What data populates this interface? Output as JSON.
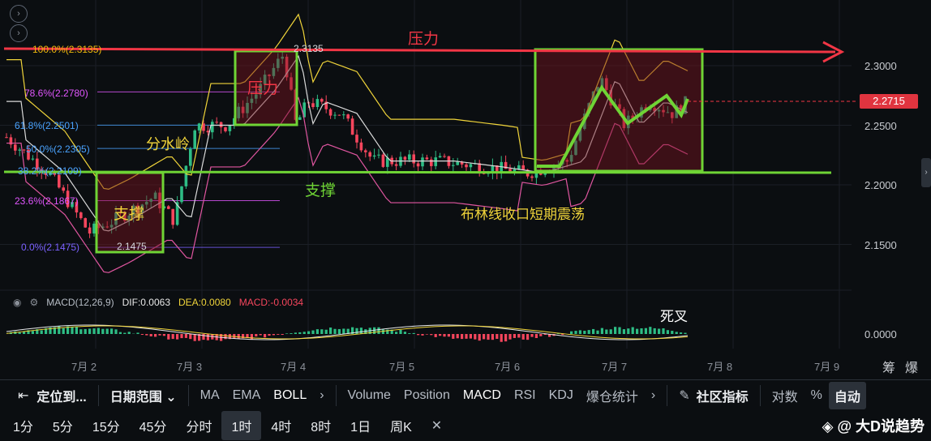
{
  "price_axis": {
    "labels": [
      "2.3000",
      "2.2500",
      "2.2000",
      "2.1500"
    ],
    "current_price": "2.2715",
    "macd_zero": "0.0000"
  },
  "date_axis": {
    "labels": [
      "7月 2",
      "7月 3",
      "7月 4",
      "7月 5",
      "7月 6",
      "7月 7",
      "7月 8",
      "7月 9"
    ],
    "right_labels": [
      "筹",
      "爆"
    ]
  },
  "fib_levels": [
    {
      "label": "100.0%(2.3135)",
      "color": "#f0b90b"
    },
    {
      "label": "78.6%(2.2780)",
      "color": "#e056fd"
    },
    {
      "label": "61.8%(2.2501)",
      "color": "#4aa3ff"
    },
    {
      "label": "50.0%(2.2305)",
      "color": "#4aa3ff"
    },
    {
      "label": "38.2%(2.2109)",
      "color": "#4aa3ff"
    },
    {
      "label": "23.6%(2.1867)",
      "color": "#e056fd"
    },
    {
      "label": "0.0%(2.1475)",
      "color": "#7b61ff"
    }
  ],
  "high_marker": "2.3135",
  "low_marker": "2.1475",
  "annotations": {
    "resistance_top": "压力",
    "resistance_box": "压力",
    "support_line": "支撑",
    "support_box": "支撑",
    "watershed": "分水岭",
    "boll_squeeze": "布林线收口短期震荡",
    "death_cross": "死叉"
  },
  "macd": {
    "title": "MACD(12,26,9)",
    "dif": "DIF:0.0063",
    "dea": "DEA:0.0080",
    "macd": "MACD:-0.0034"
  },
  "toolbar": {
    "locate": "定位到...",
    "date_range": "日期范围",
    "indicators_main": [
      "MA",
      "EMA",
      "BOLL"
    ],
    "indicators_sub": [
      "Volume",
      "Position",
      "MACD",
      "RSI",
      "KDJ",
      "爆仓统计"
    ],
    "community": "社区指标",
    "log": "对数",
    "percent": "%",
    "auto": "自动"
  },
  "intervals": [
    "1分",
    "5分",
    "15分",
    "45分",
    "分时",
    "1时",
    "4时",
    "8时",
    "1日",
    "周K"
  ],
  "active_interval": "1时",
  "watermark": "@ 大D说趋势",
  "colors": {
    "up": "#2ebd85",
    "down": "#f6465d",
    "accent_green": "#6fd435",
    "accent_red": "#f23645",
    "yellow": "#f0d43a"
  }
}
